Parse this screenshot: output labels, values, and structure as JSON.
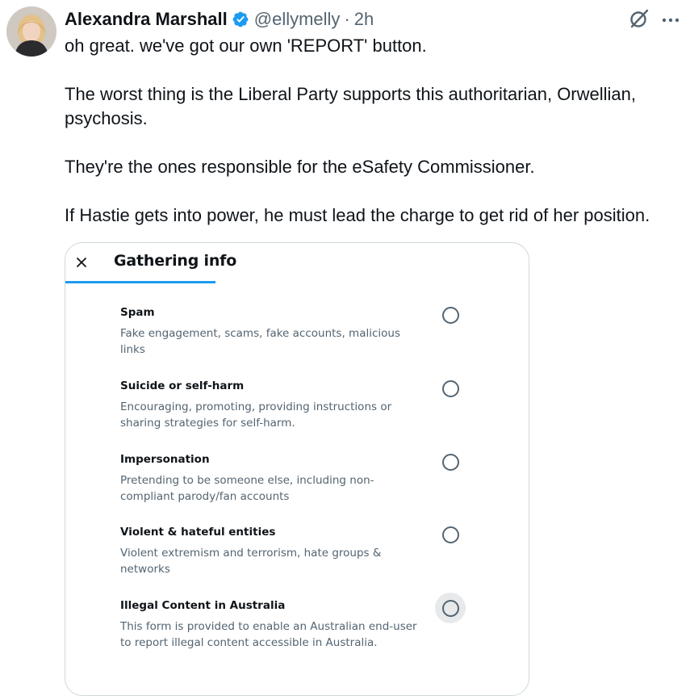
{
  "tweet": {
    "author_name": "Alexandra Marshall",
    "handle": "@ellymelly",
    "separator": "·",
    "time": "2h",
    "paragraphs": [
      "oh great. we've got our own 'REPORT' button.",
      "The worst thing is the Liberal Party supports this authoritarian, Orwellian, psychosis.",
      "They're the ones responsible for the eSafety Commissioner.",
      "If Hastie gets into power, he must lead the charge to get rid of her position."
    ],
    "icons": {
      "verified": "verified-badge-icon",
      "grok": "grok-icon",
      "more": "more-icon"
    }
  },
  "report_card": {
    "close_glyph": "×",
    "title": "Gathering info",
    "options": [
      {
        "title": "Spam",
        "description": "Fake engagement, scams, fake accounts, malicious links"
      },
      {
        "title": "Suicide or self-harm",
        "description": "Encouraging, promoting, providing instructions or sharing strategies for self-harm."
      },
      {
        "title": "Impersonation",
        "description": "Pretending to be someone else, including non-compliant parody/fan accounts"
      },
      {
        "title": "Violent & hateful entities",
        "description": "Violent extremism and terrorism, hate groups & networks"
      },
      {
        "title": "Illegal Content in Australia",
        "description": "This form is provided to enable an Australian end-user to report illegal content accessible in Australia."
      }
    ]
  },
  "colors": {
    "accent": "#1d9bf0",
    "text_primary": "#0f1419",
    "text_secondary": "#536471",
    "border": "#cfd9de"
  }
}
